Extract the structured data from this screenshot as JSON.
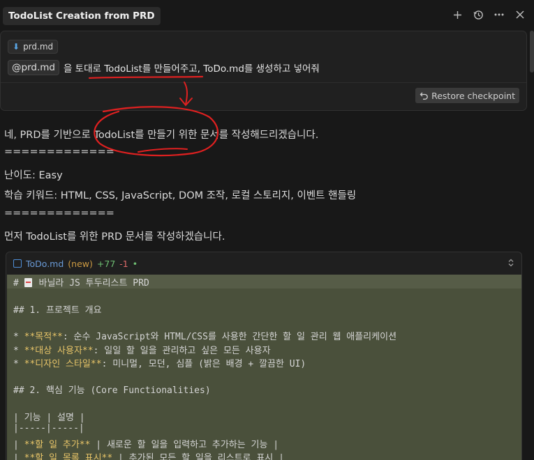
{
  "header": {
    "title": "TodoList Creation from PRD",
    "icons": [
      "plus-icon",
      "history-icon",
      "more-icon",
      "close-icon"
    ]
  },
  "user_message": {
    "attachment": "prd.md",
    "mention": "@prd.md",
    "text": "을 토대로 TodoList를 만들어주고, ToDo.md를 생성하고 넣어줘",
    "restore_label": "Restore checkpoint"
  },
  "response": {
    "lines": [
      "네, PRD를 기반으로 TodoList를 만들기 위한 문서를 작성해드리겠습니다.",
      "=============",
      "난이도: Easy",
      "학습 키워드: HTML, CSS, JavaScript, DOM 조작, 로컬 스토리지, 이벤트 핸들링",
      "=============",
      "먼저 TodoList를 위한 PRD 문서를 작성하겠습니다."
    ]
  },
  "code_block": {
    "filename": "ToDo.md",
    "status": "(new)",
    "added": "+77",
    "removed": "-1",
    "dot": "•",
    "lines": [
      {
        "pre": "# ",
        "doc": true,
        "mid": " 바닐라 JS 투두리스트 PRD",
        "y": "",
        "post": ""
      },
      {
        "pre": "",
        "mid": "",
        "y": "",
        "post": ""
      },
      {
        "pre": "## 1. 프로젝트 개요",
        "mid": "",
        "y": "",
        "post": ""
      },
      {
        "pre": "",
        "mid": "",
        "y": "",
        "post": ""
      },
      {
        "pre": "* ",
        "y": "**목적**",
        "post": ": 순수 JavaScript와 HTML/CSS를 사용한 간단한 할 일 관리 웹 애플리케이션"
      },
      {
        "pre": "* ",
        "y": "**대상 사용자**",
        "post": ": 일일 할 일을 관리하고 싶은 모든 사용자"
      },
      {
        "pre": "* ",
        "y": "**디자인 스타일**",
        "post": ": 미니멀, 모던, 심플 (밝은 배경 + 깔끔한 UI)"
      },
      {
        "pre": "",
        "mid": "",
        "y": "",
        "post": ""
      },
      {
        "pre": "## 2. 핵심 기능 (Core Functionalities)",
        "mid": "",
        "y": "",
        "post": ""
      },
      {
        "pre": "",
        "mid": "",
        "y": "",
        "post": ""
      },
      {
        "pre": "| 기능 | 설명 |",
        "mid": "",
        "y": "",
        "post": ""
      },
      {
        "pre": "|-----|-----|",
        "mid": "",
        "y": "",
        "post": ""
      },
      {
        "pre": "| ",
        "y": "**할 일 추가**",
        "post": " | 새로운 할 일을 입력하고 추가하는 기능 |"
      },
      {
        "pre": "| ",
        "y": "**할 일 목록 표시**",
        "post": " | 추가된 모든 할 일을 리스트로 표시 |"
      }
    ]
  },
  "colors": {
    "background": "#181818",
    "annotation": "#e02020",
    "code_highlight": "#4a503b"
  }
}
